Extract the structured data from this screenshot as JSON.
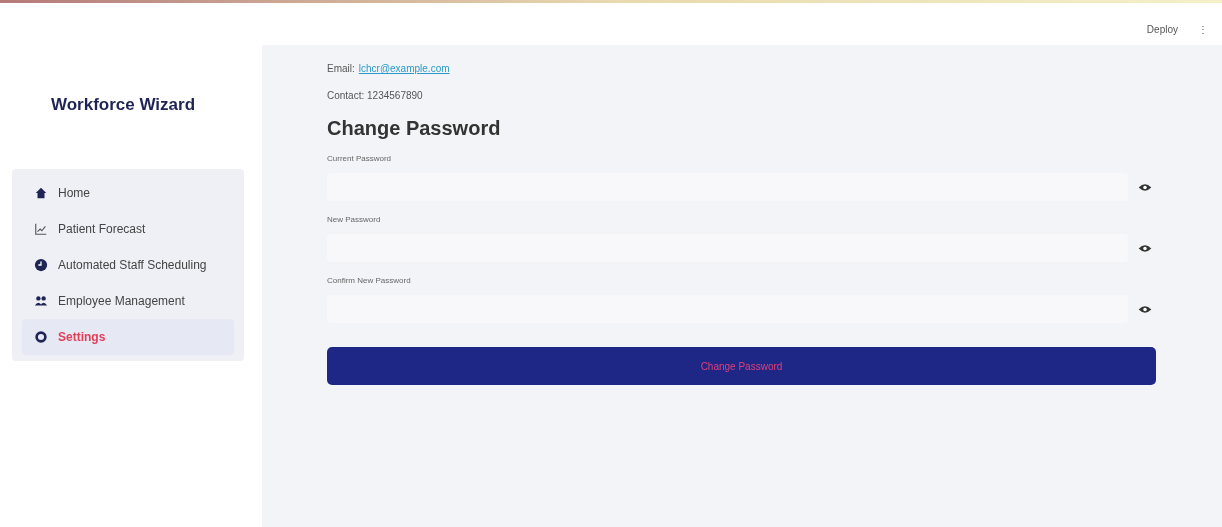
{
  "header": {
    "deploy": "Deploy",
    "menu": "⋮"
  },
  "sidebar": {
    "title": "Workforce Wizard",
    "items": [
      {
        "label": "Home",
        "kind": "home",
        "selected": false
      },
      {
        "label": "Patient Forecast",
        "kind": "chart",
        "selected": false
      },
      {
        "label": "Automated Staff Scheduling",
        "kind": "clock",
        "selected": false
      },
      {
        "label": "Employee Management",
        "kind": "people",
        "selected": false
      },
      {
        "label": "Settings",
        "kind": "gear",
        "selected": true
      }
    ]
  },
  "profile": {
    "email_label": "Email:",
    "email": "lchcr@example.com",
    "contact": "Contact: 1234567890"
  },
  "form": {
    "title": "Change Password",
    "fields": [
      {
        "label": "Current Password"
      },
      {
        "label": "New Password"
      },
      {
        "label": "Confirm New Password"
      }
    ],
    "button": "Change Password"
  }
}
